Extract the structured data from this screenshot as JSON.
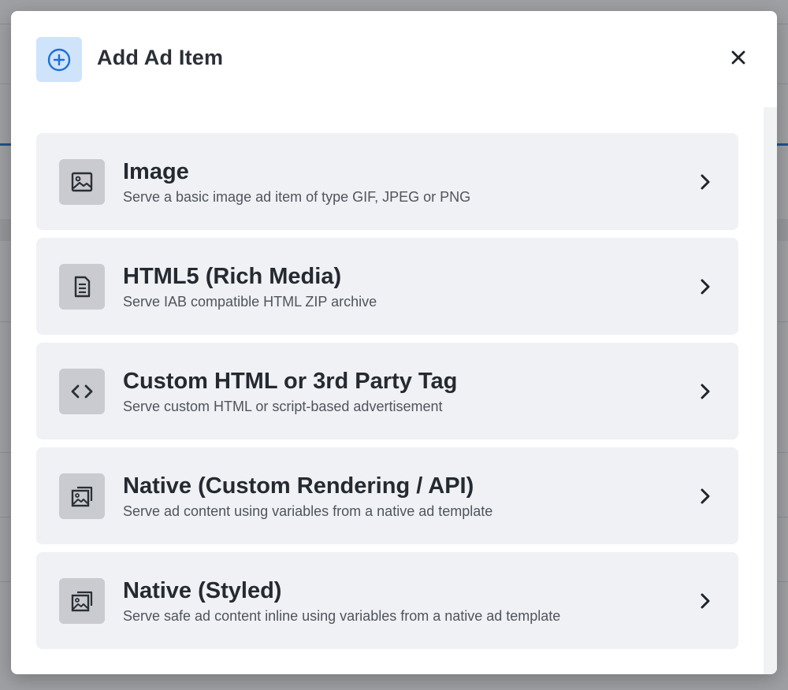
{
  "modal": {
    "title": "Add Ad Item",
    "header_icon": "plus-circle-icon",
    "close_icon": "close-icon",
    "accent_color": "#1b6fd6"
  },
  "items": [
    {
      "title": "Image",
      "description": "Serve a basic image ad item of type GIF, JPEG or PNG",
      "icon": "image-icon"
    },
    {
      "title": "HTML5 (Rich Media)",
      "description": "Serve IAB compatible HTML ZIP archive",
      "icon": "document-icon"
    },
    {
      "title": "Custom HTML or 3rd Party Tag",
      "description": "Serve custom HTML or script-based advertisement",
      "icon": "code-icon"
    },
    {
      "title": "Native (Custom Rendering / API)",
      "description": "Serve ad content using variables from a native ad template",
      "icon": "gallery-icon"
    },
    {
      "title": "Native (Styled)",
      "description": "Serve safe ad content inline using variables from a native ad template",
      "icon": "gallery-icon"
    }
  ]
}
